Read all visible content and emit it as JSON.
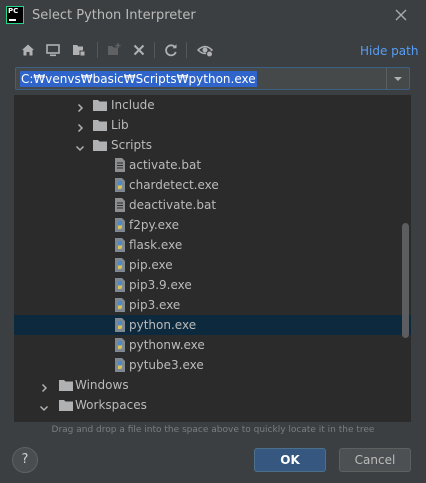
{
  "window": {
    "title": "Select Python Interpreter",
    "app_logo_text": "PC"
  },
  "toolbar": {
    "buttons": [
      {
        "name": "home-directory",
        "icon": "home-icon"
      },
      {
        "name": "desktop-directory",
        "icon": "desktop-icon"
      },
      {
        "name": "project-directory",
        "icon": "project-folder-icon"
      },
      {
        "name": "new-folder",
        "icon": "new-folder-icon",
        "enabled": false
      },
      {
        "name": "delete",
        "icon": "delete-x-icon"
      },
      {
        "name": "refresh",
        "icon": "refresh-icon"
      },
      {
        "name": "show-hidden-files",
        "icon": "eye-icon"
      }
    ],
    "hide_path_label": "Hide path"
  },
  "path": {
    "value": "C:₩venvs₩basic₩Scripts₩python.exe"
  },
  "tree": {
    "rows": [
      {
        "label": "Include",
        "type": "folder",
        "expanded": false,
        "level": 2
      },
      {
        "label": "Lib",
        "type": "folder",
        "expanded": false,
        "level": 2
      },
      {
        "label": "Scripts",
        "type": "folder",
        "expanded": true,
        "level": 2
      },
      {
        "label": "activate.bat",
        "type": "file-bat",
        "level": 3
      },
      {
        "label": "chardetect.exe",
        "type": "file-python-exe",
        "level": 3
      },
      {
        "label": "deactivate.bat",
        "type": "file-bat",
        "level": 3
      },
      {
        "label": "f2py.exe",
        "type": "file-python-exe",
        "level": 3
      },
      {
        "label": "flask.exe",
        "type": "file-python-exe",
        "level": 3
      },
      {
        "label": "pip.exe",
        "type": "file-python-exe",
        "level": 3
      },
      {
        "label": "pip3.9.exe",
        "type": "file-python-exe",
        "level": 3
      },
      {
        "label": "pip3.exe",
        "type": "file-python-exe",
        "level": 3
      },
      {
        "label": "python.exe",
        "type": "file-python-exe",
        "level": 3,
        "selected": true
      },
      {
        "label": "pythonw.exe",
        "type": "file-python-exe",
        "level": 3
      },
      {
        "label": "pytube3.exe",
        "type": "file-python-exe",
        "level": 3
      },
      {
        "label": "Windows",
        "type": "folder",
        "expanded": false,
        "level": 1
      },
      {
        "label": "Workspaces",
        "type": "folder",
        "expanded": true,
        "level": 1
      }
    ]
  },
  "hint": "Drag and drop a file into the space above to quickly locate it in the tree",
  "buttons": {
    "help": "?",
    "ok": "OK",
    "cancel": "Cancel"
  },
  "colors": {
    "background": "#3c3f41",
    "tree_background": "#2b2b2b",
    "selection": "#0d293e",
    "accent_link": "#589df6",
    "ok_button": "#365880",
    "text": "#bbbbbb"
  }
}
